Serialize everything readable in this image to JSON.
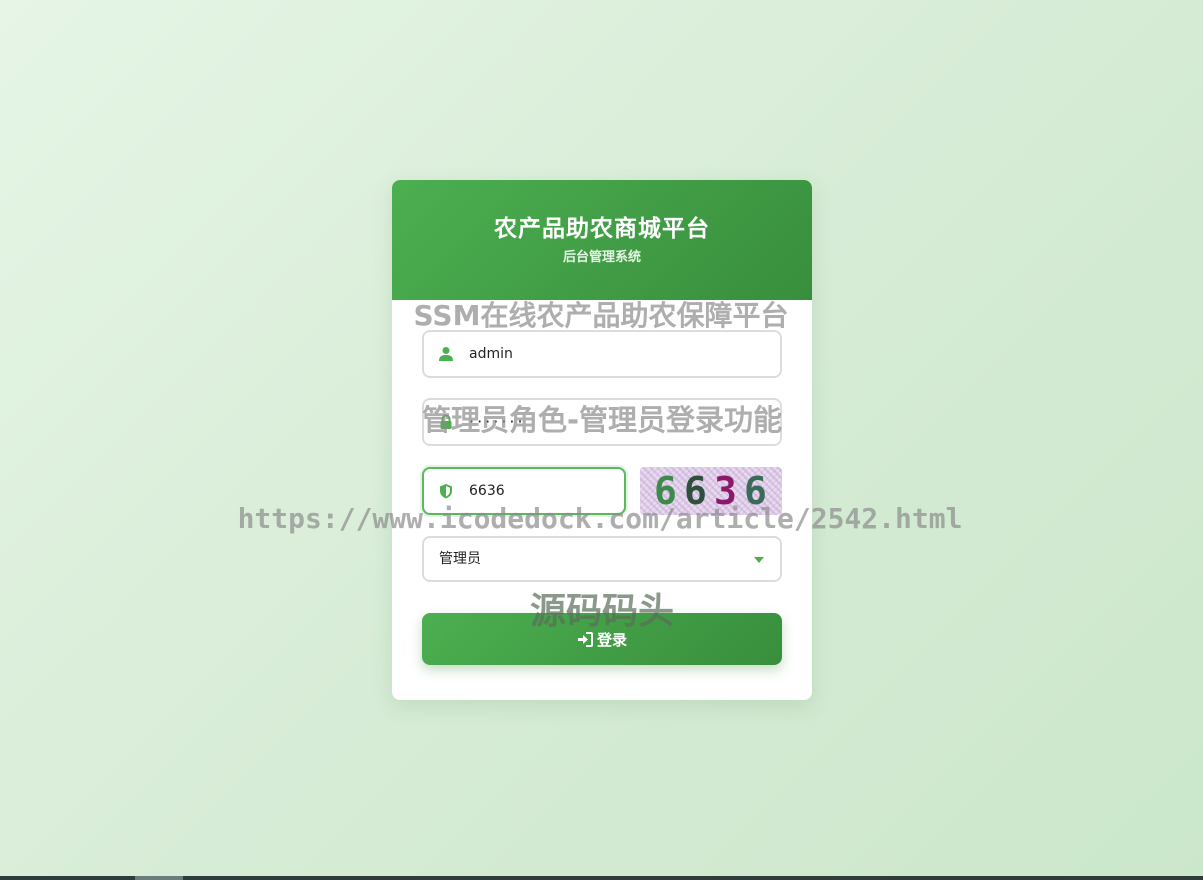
{
  "header": {
    "title": "农产品助农商城平台",
    "subtitle": "后台管理系统"
  },
  "form": {
    "username_value": "admin",
    "password_value": "·······",
    "captcha_value": "6636",
    "captcha_image_text": [
      "6",
      "6",
      "3",
      "6"
    ],
    "role_selected": "管理员",
    "login_label": "登录"
  },
  "icons": {
    "username": "user-icon",
    "password": "lock-icon",
    "captcha": "shield-icon",
    "role": "caret-down-icon",
    "login": "sign-in-icon"
  },
  "colors": {
    "primary": "#4caf50",
    "primary_dark": "#388e3c",
    "background": "#d7ecd6"
  },
  "watermarks": [
    "SSM在线农产品助农保障平台",
    "管理员角色-管理员登录功能",
    "https://www.icodedock.com/article/2542.html",
    "源码码头"
  ]
}
